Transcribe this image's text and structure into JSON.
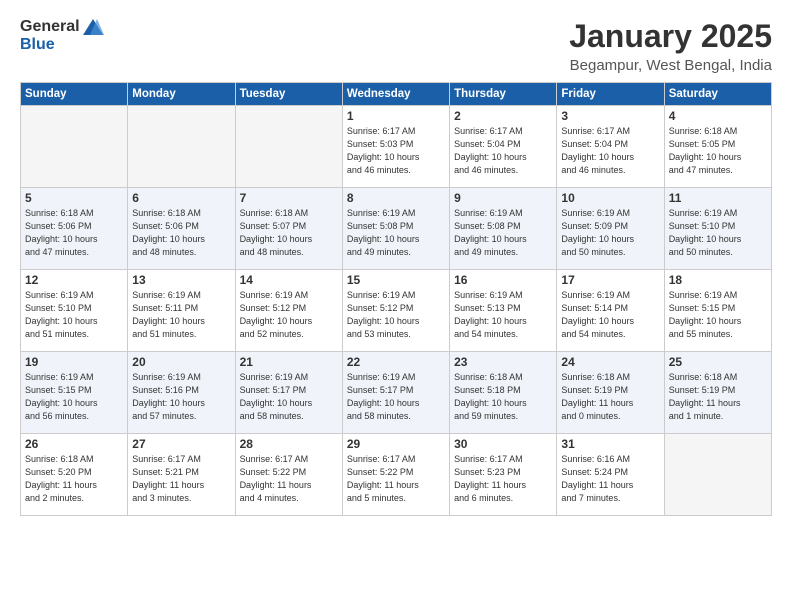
{
  "logo": {
    "general": "General",
    "blue": "Blue"
  },
  "title": "January 2025",
  "subtitle": "Begampur, West Bengal, India",
  "weekdays": [
    "Sunday",
    "Monday",
    "Tuesday",
    "Wednesday",
    "Thursday",
    "Friday",
    "Saturday"
  ],
  "weeks": [
    {
      "shaded": false,
      "days": [
        {
          "num": "",
          "info": ""
        },
        {
          "num": "",
          "info": ""
        },
        {
          "num": "",
          "info": ""
        },
        {
          "num": "1",
          "info": "Sunrise: 6:17 AM\nSunset: 5:03 PM\nDaylight: 10 hours\nand 46 minutes."
        },
        {
          "num": "2",
          "info": "Sunrise: 6:17 AM\nSunset: 5:04 PM\nDaylight: 10 hours\nand 46 minutes."
        },
        {
          "num": "3",
          "info": "Sunrise: 6:17 AM\nSunset: 5:04 PM\nDaylight: 10 hours\nand 46 minutes."
        },
        {
          "num": "4",
          "info": "Sunrise: 6:18 AM\nSunset: 5:05 PM\nDaylight: 10 hours\nand 47 minutes."
        }
      ]
    },
    {
      "shaded": true,
      "days": [
        {
          "num": "5",
          "info": "Sunrise: 6:18 AM\nSunset: 5:06 PM\nDaylight: 10 hours\nand 47 minutes."
        },
        {
          "num": "6",
          "info": "Sunrise: 6:18 AM\nSunset: 5:06 PM\nDaylight: 10 hours\nand 48 minutes."
        },
        {
          "num": "7",
          "info": "Sunrise: 6:18 AM\nSunset: 5:07 PM\nDaylight: 10 hours\nand 48 minutes."
        },
        {
          "num": "8",
          "info": "Sunrise: 6:19 AM\nSunset: 5:08 PM\nDaylight: 10 hours\nand 49 minutes."
        },
        {
          "num": "9",
          "info": "Sunrise: 6:19 AM\nSunset: 5:08 PM\nDaylight: 10 hours\nand 49 minutes."
        },
        {
          "num": "10",
          "info": "Sunrise: 6:19 AM\nSunset: 5:09 PM\nDaylight: 10 hours\nand 50 minutes."
        },
        {
          "num": "11",
          "info": "Sunrise: 6:19 AM\nSunset: 5:10 PM\nDaylight: 10 hours\nand 50 minutes."
        }
      ]
    },
    {
      "shaded": false,
      "days": [
        {
          "num": "12",
          "info": "Sunrise: 6:19 AM\nSunset: 5:10 PM\nDaylight: 10 hours\nand 51 minutes."
        },
        {
          "num": "13",
          "info": "Sunrise: 6:19 AM\nSunset: 5:11 PM\nDaylight: 10 hours\nand 51 minutes."
        },
        {
          "num": "14",
          "info": "Sunrise: 6:19 AM\nSunset: 5:12 PM\nDaylight: 10 hours\nand 52 minutes."
        },
        {
          "num": "15",
          "info": "Sunrise: 6:19 AM\nSunset: 5:12 PM\nDaylight: 10 hours\nand 53 minutes."
        },
        {
          "num": "16",
          "info": "Sunrise: 6:19 AM\nSunset: 5:13 PM\nDaylight: 10 hours\nand 54 minutes."
        },
        {
          "num": "17",
          "info": "Sunrise: 6:19 AM\nSunset: 5:14 PM\nDaylight: 10 hours\nand 54 minutes."
        },
        {
          "num": "18",
          "info": "Sunrise: 6:19 AM\nSunset: 5:15 PM\nDaylight: 10 hours\nand 55 minutes."
        }
      ]
    },
    {
      "shaded": true,
      "days": [
        {
          "num": "19",
          "info": "Sunrise: 6:19 AM\nSunset: 5:15 PM\nDaylight: 10 hours\nand 56 minutes."
        },
        {
          "num": "20",
          "info": "Sunrise: 6:19 AM\nSunset: 5:16 PM\nDaylight: 10 hours\nand 57 minutes."
        },
        {
          "num": "21",
          "info": "Sunrise: 6:19 AM\nSunset: 5:17 PM\nDaylight: 10 hours\nand 58 minutes."
        },
        {
          "num": "22",
          "info": "Sunrise: 6:19 AM\nSunset: 5:17 PM\nDaylight: 10 hours\nand 58 minutes."
        },
        {
          "num": "23",
          "info": "Sunrise: 6:18 AM\nSunset: 5:18 PM\nDaylight: 10 hours\nand 59 minutes."
        },
        {
          "num": "24",
          "info": "Sunrise: 6:18 AM\nSunset: 5:19 PM\nDaylight: 11 hours\nand 0 minutes."
        },
        {
          "num": "25",
          "info": "Sunrise: 6:18 AM\nSunset: 5:19 PM\nDaylight: 11 hours\nand 1 minute."
        }
      ]
    },
    {
      "shaded": false,
      "days": [
        {
          "num": "26",
          "info": "Sunrise: 6:18 AM\nSunset: 5:20 PM\nDaylight: 11 hours\nand 2 minutes."
        },
        {
          "num": "27",
          "info": "Sunrise: 6:17 AM\nSunset: 5:21 PM\nDaylight: 11 hours\nand 3 minutes."
        },
        {
          "num": "28",
          "info": "Sunrise: 6:17 AM\nSunset: 5:22 PM\nDaylight: 11 hours\nand 4 minutes."
        },
        {
          "num": "29",
          "info": "Sunrise: 6:17 AM\nSunset: 5:22 PM\nDaylight: 11 hours\nand 5 minutes."
        },
        {
          "num": "30",
          "info": "Sunrise: 6:17 AM\nSunset: 5:23 PM\nDaylight: 11 hours\nand 6 minutes."
        },
        {
          "num": "31",
          "info": "Sunrise: 6:16 AM\nSunset: 5:24 PM\nDaylight: 11 hours\nand 7 minutes."
        },
        {
          "num": "",
          "info": ""
        }
      ]
    }
  ]
}
